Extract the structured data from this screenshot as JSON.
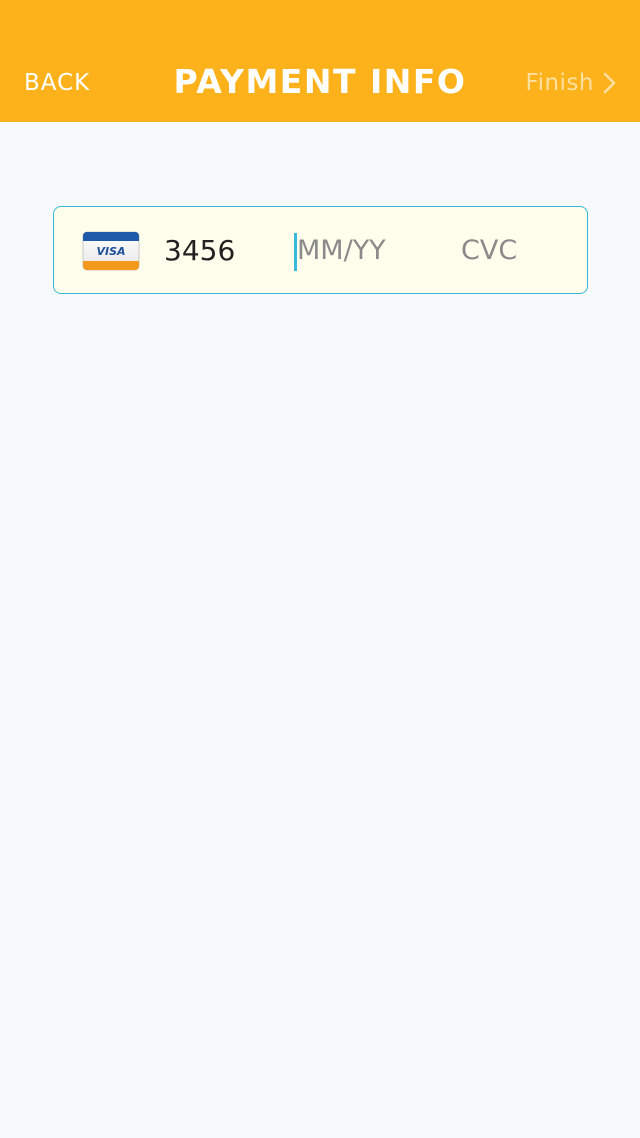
{
  "header": {
    "back_label": "BACK",
    "title": "PAYMENT INFO",
    "finish_label": "Finish"
  },
  "card_form": {
    "card_brand_icon": "visa-card-icon",
    "card_brand_text": "VISA",
    "card_number": "3456",
    "expiry_placeholder": "MM/YY",
    "cvc_placeholder": "CVC"
  },
  "colors": {
    "header_bg": "#fdb21c",
    "accent": "#36b8da",
    "field_bg": "#fffeec",
    "page_bg": "#f8f9fb"
  }
}
